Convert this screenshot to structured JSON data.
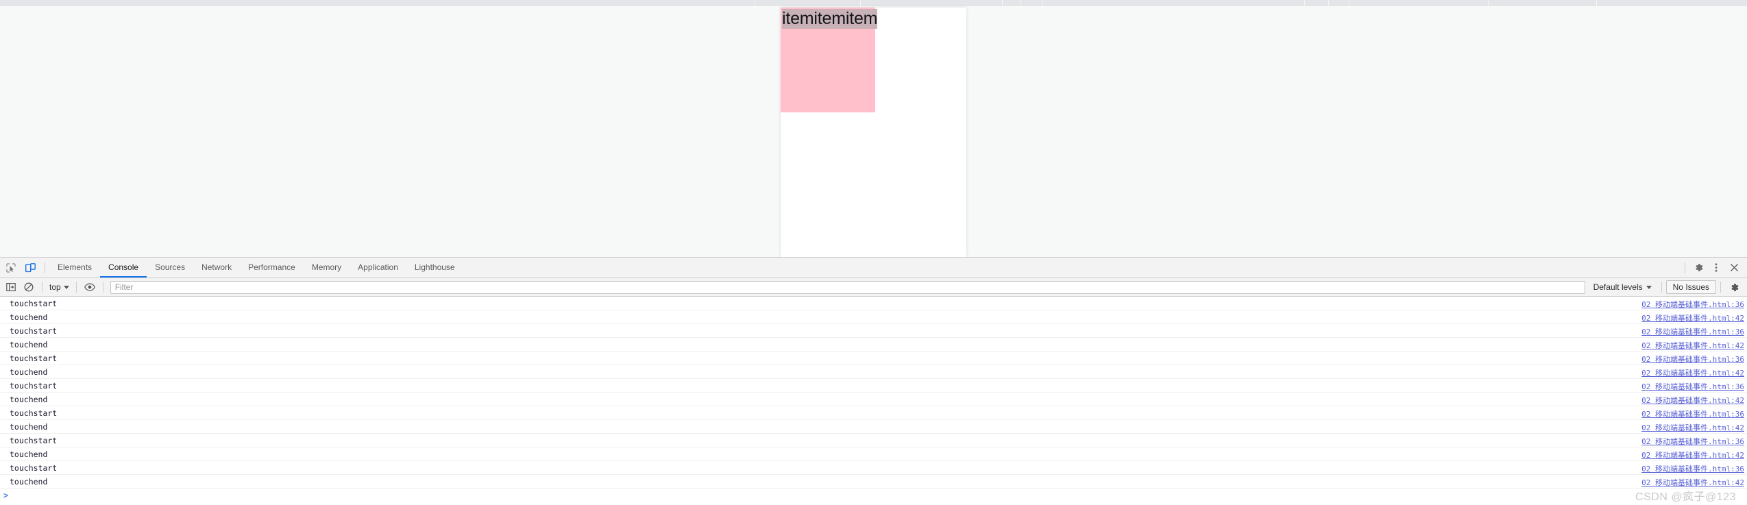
{
  "page": {
    "item_text": "itemitemitem",
    "box_color": "#ffc0cb",
    "selection_color": "#c8b2b7"
  },
  "devtools": {
    "icons": {
      "inspect": "inspect-cursor-icon",
      "device": "device-toolbar-icon",
      "settings": "gear-icon",
      "more": "kebab-menu-icon",
      "close": "close-icon"
    },
    "tabs": [
      {
        "label": "Elements",
        "active": false
      },
      {
        "label": "Console",
        "active": true
      },
      {
        "label": "Sources",
        "active": false
      },
      {
        "label": "Network",
        "active": false
      },
      {
        "label": "Performance",
        "active": false
      },
      {
        "label": "Memory",
        "active": false
      },
      {
        "label": "Application",
        "active": false
      },
      {
        "label": "Lighthouse",
        "active": false
      }
    ],
    "console_toolbar": {
      "clear_icon": "clear-console-icon",
      "sidebar_icon": "console-sidebar-icon",
      "context": "top",
      "eye_icon": "live-expression-icon",
      "filter_placeholder": "Filter",
      "filter_value": "",
      "levels": "Default levels",
      "issues": "No Issues",
      "settings_icon": "gear-icon"
    },
    "logs": [
      {
        "message": "touchstart",
        "source": "02 移动端基础事件.html:36"
      },
      {
        "message": "touchend",
        "source": "02 移动端基础事件.html:42"
      },
      {
        "message": "touchstart",
        "source": "02 移动端基础事件.html:36"
      },
      {
        "message": "touchend",
        "source": "02 移动端基础事件.html:42"
      },
      {
        "message": "touchstart",
        "source": "02 移动端基础事件.html:36"
      },
      {
        "message": "touchend",
        "source": "02 移动端基础事件.html:42"
      },
      {
        "message": "touchstart",
        "source": "02 移动端基础事件.html:36"
      },
      {
        "message": "touchend",
        "source": "02 移动端基础事件.html:42"
      },
      {
        "message": "touchstart",
        "source": "02 移动端基础事件.html:36"
      },
      {
        "message": "touchend",
        "source": "02 移动端基础事件.html:42"
      },
      {
        "message": "touchstart",
        "source": "02 移动端基础事件.html:36"
      },
      {
        "message": "touchend",
        "source": "02 移动端基础事件.html:42"
      },
      {
        "message": "touchstart",
        "source": "02 移动端基础事件.html:36"
      },
      {
        "message": "touchend",
        "source": "02 移动端基础事件.html:42"
      }
    ],
    "prompt": ">"
  },
  "watermark": "CSDN @疯子@123"
}
